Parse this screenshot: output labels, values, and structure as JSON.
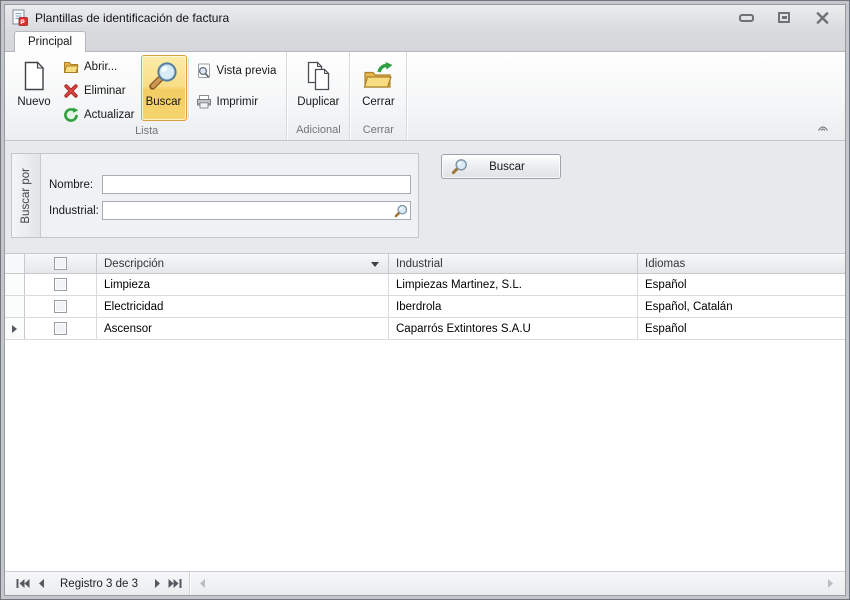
{
  "window": {
    "title": "Plantillas de identificación de factura"
  },
  "ribbon": {
    "tab": "Principal",
    "buttons": {
      "nuevo": "Nuevo",
      "abrir": "Abrir...",
      "eliminar": "Eliminar",
      "actualizar": "Actualizar",
      "buscar": "Buscar",
      "vista_previa": "Vista previa",
      "imprimir": "Imprimir",
      "duplicar": "Duplicar",
      "cerrar": "Cerrar"
    },
    "groups": {
      "lista": "Lista",
      "adicional": "Adicional",
      "cerrar": "Cerrar"
    }
  },
  "search_panel": {
    "caption": "Buscar por",
    "nombre_label": "Nombre:",
    "nombre_value": "",
    "industrial_label": "Industrial:",
    "industrial_value": "",
    "buscar_button": "Buscar"
  },
  "grid": {
    "columns": {
      "descripcion": "Descripción",
      "industrial": "Industrial",
      "idiomas": "Idiomas"
    },
    "rows": [
      {
        "descripcion": "Limpieza",
        "industrial": "Limpiezas Martinez, S.L.",
        "idiomas": "Español",
        "checked": false,
        "focused": false
      },
      {
        "descripcion": "Electricidad",
        "industrial": "Iberdrola",
        "idiomas": "Español, Catalán",
        "checked": false,
        "focused": false
      },
      {
        "descripcion": "Ascensor",
        "industrial": "Caparrós Extintores S.A.U",
        "idiomas": "Español",
        "checked": false,
        "focused": true
      }
    ]
  },
  "status_bar": {
    "record_label": "Registro 3 de 3"
  },
  "icons": {
    "app-icon": "document-with-red-pdf-badge",
    "nuevo-icon": "blank-page",
    "abrir-icon": "open-folder",
    "eliminar-icon": "red-cross",
    "actualizar-icon": "green-refresh-arrows",
    "buscar-icon": "magnifier",
    "vista-previa-icon": "page-with-magnifier",
    "imprimir-icon": "printer",
    "duplicar-icon": "two-pages",
    "cerrar-icon": "folder-with-green-arrow",
    "collapse-ribbon-icon": "chevron-up",
    "minimize-icon": "minimize-bar",
    "maximize-icon": "maximize-box",
    "close-icon": "close-x",
    "nav-first-icon": "bar-double-triangle-left",
    "nav-prev-icon": "triangle-left",
    "nav-next-icon": "triangle-right",
    "nav-last-icon": "double-triangle-right-bar",
    "sort-arrow-icon": "triangle-down",
    "focused-row-icon": "triangle-right"
  },
  "colors": {
    "highlight_button_bg": "#F6DC7E",
    "highlight_button_border": "#D8A23F",
    "titlebar_bg": "#DDDFE2",
    "content_bg": "#E7E9EC",
    "grid_line": "#D8DADD",
    "header_gradient_bottom": "#E5E7EA",
    "glyph_gray": "#6E7277",
    "folder_yellow": "#F2C75D",
    "refresh_green": "#2F9E3F",
    "delete_red": "#C22B28"
  }
}
